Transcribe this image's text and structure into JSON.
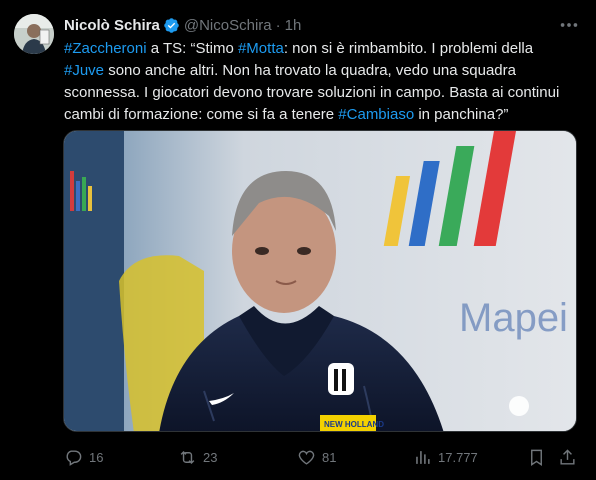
{
  "author": {
    "name": "Nicolò Schira",
    "handle": "@NicoSchira",
    "separator": "·",
    "time": "1h"
  },
  "tweet_lines": [
    [
      {
        "t": "#Zaccheroni",
        "tag": true
      },
      {
        "t": " a TS: “Stimo "
      },
      {
        "t": "#Motta",
        "tag": true
      },
      {
        "t": ": non si è rimbambito. I problemi della"
      }
    ],
    [
      {
        "t": "#Juve",
        "tag": true
      },
      {
        "t": " sono anche altri. Non ha trovato la quadra, vedo una squadra"
      }
    ],
    [
      {
        "t": "sconnessa. I giocatori devono trovare soluzioni in campo. Basta ai continui"
      }
    ],
    [
      {
        "t": "cambi di formazione: come si fa a tenere "
      },
      {
        "t": "#Cambiaso",
        "tag": true
      },
      {
        "t": " in panchina?”"
      }
    ]
  ],
  "media": {
    "jacket_sponsor": "NEW HOLLAND",
    "banner_text": "Mapei"
  },
  "actions": {
    "replies": "16",
    "reposts": "23",
    "likes": "81",
    "views": "17.777"
  },
  "colors": {
    "accent": "#1d9bf0",
    "muted": "#71767b",
    "background": "#000000"
  },
  "icons": [
    "more-icon",
    "verified-icon",
    "reply-icon",
    "repost-icon",
    "like-icon",
    "views-icon",
    "bookmark-icon",
    "share-icon"
  ]
}
